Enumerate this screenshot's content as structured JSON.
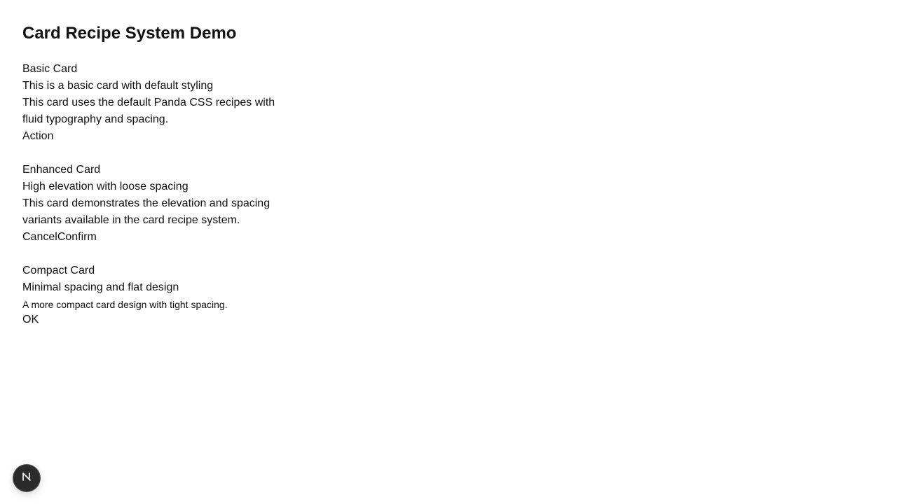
{
  "page": {
    "title": "Card Recipe System Demo"
  },
  "cards": [
    {
      "title": "Basic Card",
      "subtitle": "This is a basic card with default styling",
      "body": "This card uses the default Panda CSS recipes with fluid typography and spacing.",
      "actions": [
        "Action"
      ]
    },
    {
      "title": "Enhanced Card",
      "subtitle": "High elevation with loose spacing",
      "body": "This card demonstrates the elevation and spacing variants available in the card recipe system.",
      "actions": [
        "Cancel",
        "Confirm"
      ]
    },
    {
      "title": "Compact Card",
      "subtitle": "Minimal spacing and flat design",
      "body": "A more compact card design with tight spacing.",
      "actions": [
        "OK"
      ]
    }
  ],
  "badge": {
    "icon": "nextjs-logo-icon",
    "background": "#2b2b2b"
  }
}
